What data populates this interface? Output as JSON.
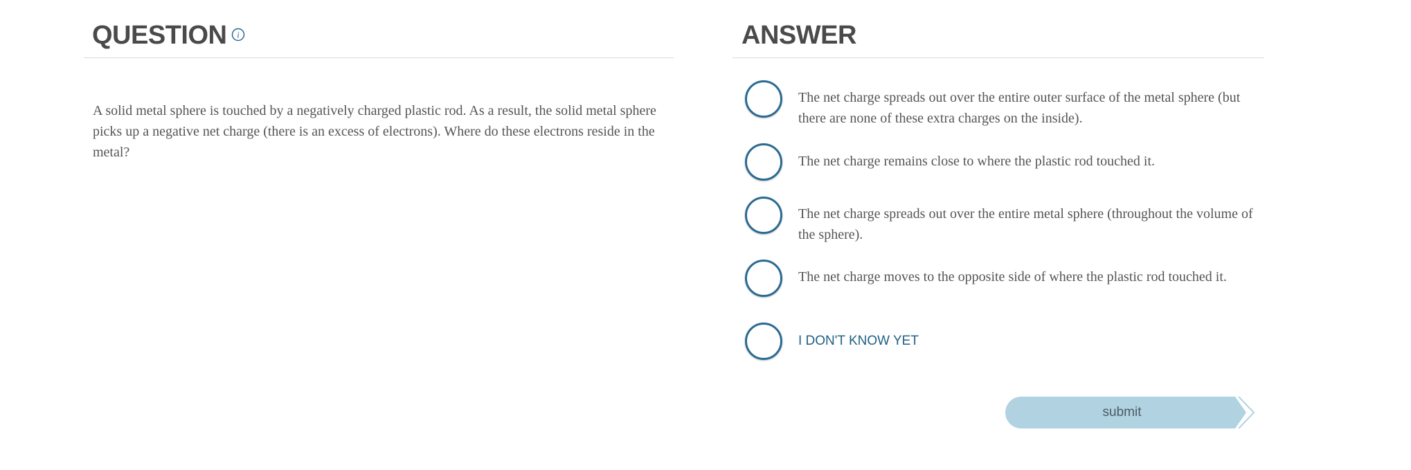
{
  "question": {
    "title": "QUESTION",
    "info_icon": "info-icon",
    "text": "A solid metal sphere is touched by a negatively charged plastic rod. As a result, the solid metal sphere picks up a negative net charge (there is an excess of electrons). Where do these electrons reside in the metal?"
  },
  "answer": {
    "title": "ANSWER",
    "options": [
      {
        "label": "The net charge spreads out over the entire outer surface of the metal sphere (but there are none of these extra charges on the inside)."
      },
      {
        "label": "The net charge remains close to where the plastic rod touched it."
      },
      {
        "label": "The net charge spreads out over the entire metal sphere (throughout the volume of the sphere)."
      },
      {
        "label": "The net charge moves to the opposite side of where the plastic rod touched it."
      },
      {
        "label": "I DON'T KNOW YET"
      }
    ],
    "submit_label": "submit"
  },
  "colors": {
    "radio_border": "#2a6a92",
    "submit_fill": "#b1d3e1",
    "idk_text": "#1f5f82",
    "title_text": "#4a4a4a"
  }
}
